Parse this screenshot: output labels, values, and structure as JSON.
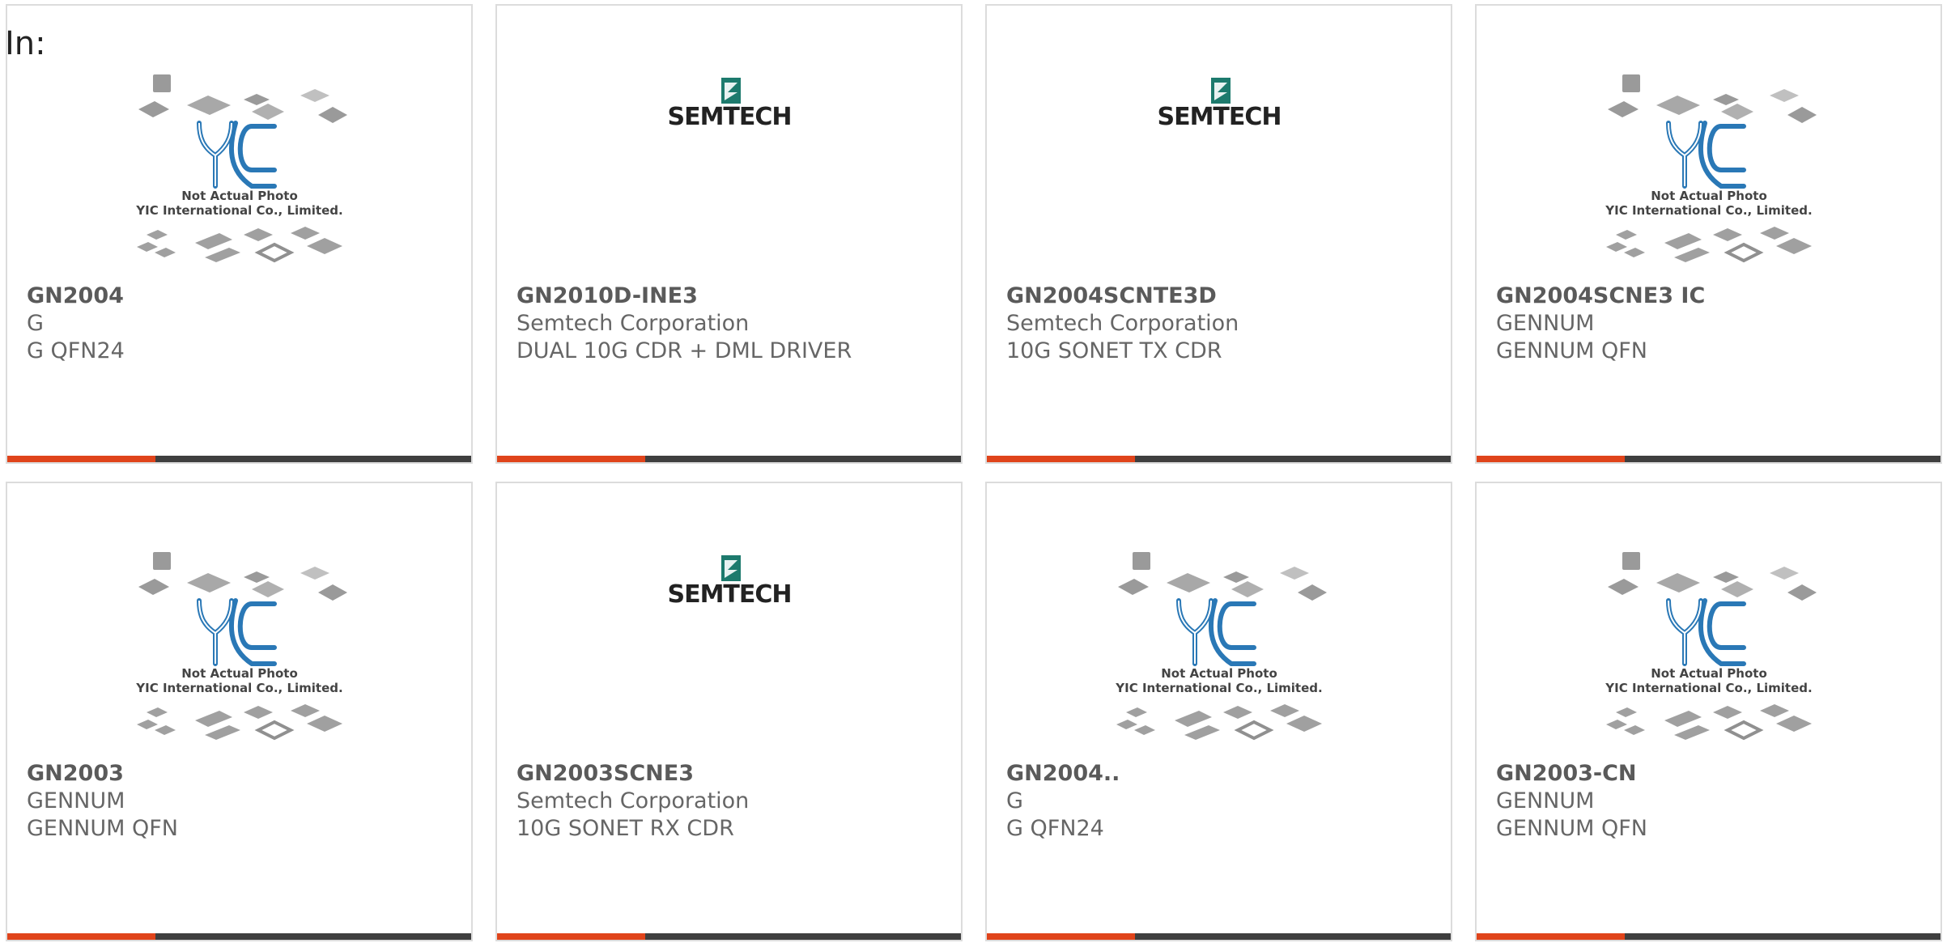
{
  "header": {
    "in_label": "In:"
  },
  "colors": {
    "accent": "#e0441b",
    "bar": "#3f3f3f"
  },
  "placeholder": {
    "line1": "Not Actual Photo",
    "line2": "YIC International Co., Limited.",
    "logo_text": "YIC"
  },
  "semtech_logo_text": "SEMTECH",
  "products": [
    {
      "part": "GN2004",
      "manufacturer": "G",
      "description": "G QFN24",
      "image": "placeholder"
    },
    {
      "part": "GN2010D-INE3",
      "manufacturer": "Semtech Corporation",
      "description": "DUAL 10G CDR + DML DRIVER",
      "image": "semtech"
    },
    {
      "part": "GN2004SCNTE3D",
      "manufacturer": "Semtech Corporation",
      "description": "10G SONET TX CDR",
      "image": "semtech"
    },
    {
      "part": "GN2004SCNE3 IC",
      "manufacturer": "GENNUM",
      "description": "GENNUM QFN",
      "image": "placeholder"
    },
    {
      "part": "GN2003",
      "manufacturer": "GENNUM",
      "description": "GENNUM QFN",
      "image": "placeholder"
    },
    {
      "part": "GN2003SCNE3",
      "manufacturer": "Semtech Corporation",
      "description": "10G SONET RX CDR",
      "image": "semtech"
    },
    {
      "part": "GN2004..",
      "manufacturer": "G",
      "description": "G QFN24",
      "image": "placeholder"
    },
    {
      "part": "GN2003-CN",
      "manufacturer": "GENNUM",
      "description": "GENNUM QFN",
      "image": "placeholder"
    }
  ]
}
